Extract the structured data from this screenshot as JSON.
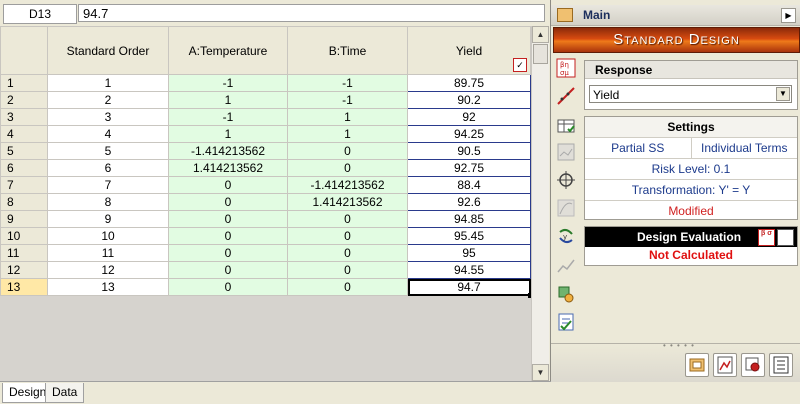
{
  "formula_bar": {
    "cell_ref": "D13",
    "value": "94.7"
  },
  "grid": {
    "headers": {
      "col1": "Standard Order",
      "col2": "A:Temperature",
      "col3": "B:Time",
      "col4": "Yield"
    },
    "rows": [
      {
        "num": "1",
        "so": "1",
        "a": "-1",
        "b": "-1",
        "y": "89.75"
      },
      {
        "num": "2",
        "so": "2",
        "a": "1",
        "b": "-1",
        "y": "90.2"
      },
      {
        "num": "3",
        "so": "3",
        "a": "-1",
        "b": "1",
        "y": "92"
      },
      {
        "num": "4",
        "so": "4",
        "a": "1",
        "b": "1",
        "y": "94.25"
      },
      {
        "num": "5",
        "so": "5",
        "a": "-1.414213562",
        "b": "0",
        "y": "90.5"
      },
      {
        "num": "6",
        "so": "6",
        "a": "1.414213562",
        "b": "0",
        "y": "92.75"
      },
      {
        "num": "7",
        "so": "7",
        "a": "0",
        "b": "-1.414213562",
        "y": "88.4"
      },
      {
        "num": "8",
        "so": "8",
        "a": "0",
        "b": "1.414213562",
        "y": "92.6"
      },
      {
        "num": "9",
        "so": "9",
        "a": "0",
        "b": "0",
        "y": "94.85"
      },
      {
        "num": "10",
        "so": "10",
        "a": "0",
        "b": "0",
        "y": "95.45"
      },
      {
        "num": "11",
        "so": "11",
        "a": "0",
        "b": "0",
        "y": "95"
      },
      {
        "num": "12",
        "so": "12",
        "a": "0",
        "b": "0",
        "y": "94.55"
      },
      {
        "num": "13",
        "so": "13",
        "a": "0",
        "b": "0",
        "y": "94.7"
      }
    ]
  },
  "tabs": {
    "design": "Design",
    "data": "Data"
  },
  "panel": {
    "header": "Main",
    "banner": "Standard Design",
    "response": {
      "title": "Response",
      "selected": "Yield"
    },
    "settings": {
      "title": "Settings",
      "partial": "Partial SS",
      "terms": "Individual Terms",
      "risk": "Risk Level: 0.1",
      "transform": "Transformation: Y' = Y",
      "modified": "Modified"
    },
    "evaluation": {
      "title": "Design Evaluation",
      "status": "Not Calculated"
    }
  },
  "colors": {
    "factor_bg": "#e2fce2",
    "banner": "#d84b10",
    "modified": "#d02020",
    "status": "#e01010"
  }
}
